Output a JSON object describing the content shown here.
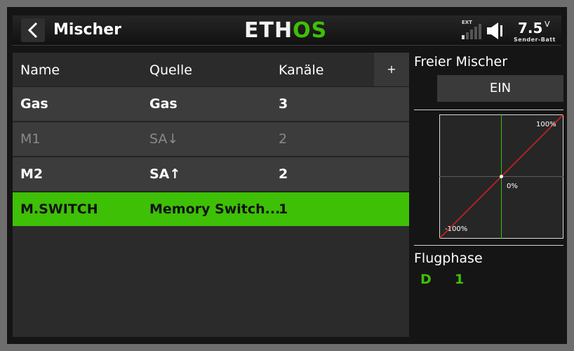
{
  "header": {
    "title": "Mischer",
    "logo_part1": "ETH",
    "logo_part2": "OS",
    "ext_label": "EXT",
    "battery_value": "7.5",
    "battery_unit": "V",
    "battery_label": "Sender-Batt"
  },
  "table": {
    "columns": [
      "Name",
      "Quelle",
      "Kanäle"
    ],
    "add_label": "+",
    "rows": [
      {
        "name": "Gas",
        "source": "Gas",
        "channels": "3",
        "state": "active"
      },
      {
        "name": "M1",
        "source": "SA↓",
        "channels": "2",
        "state": "inactive"
      },
      {
        "name": "M2",
        "source": "SA↑",
        "channels": "2",
        "state": "active"
      },
      {
        "name": "M.SWITCH",
        "source": "Memory Switch...",
        "channels": "1",
        "state": "selected"
      }
    ]
  },
  "panel": {
    "free_mixer_label": "Freier Mischer",
    "free_mixer_value": "EIN",
    "graph_top_label": "100%",
    "graph_center_label": "0%",
    "graph_bottom_label": "-100%",
    "flight_phase_label": "Flugphase",
    "flight_phases": [
      "D",
      "1"
    ]
  },
  "colors": {
    "accent": "#3ec007",
    "curve": "#e02020"
  }
}
